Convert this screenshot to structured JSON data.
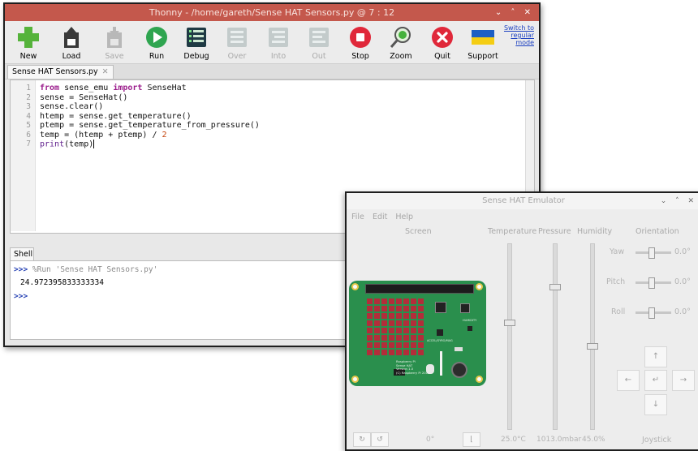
{
  "thonny": {
    "title": "Thonny  -  /home/gareth/Sense HAT Sensors.py  @  7 : 12",
    "window_controls": "⌄ ˄ ✕",
    "toolbar": [
      {
        "label": "New",
        "icon": "new-file-icon",
        "enabled": true
      },
      {
        "label": "Load",
        "icon": "load-icon",
        "enabled": true
      },
      {
        "label": "Save",
        "icon": "save-icon",
        "enabled": false
      },
      {
        "label": "Run",
        "icon": "run-icon",
        "enabled": true
      },
      {
        "label": "Debug",
        "icon": "debug-icon",
        "enabled": true
      },
      {
        "label": "Over",
        "icon": "step-over-icon",
        "enabled": false
      },
      {
        "label": "Into",
        "icon": "step-into-icon",
        "enabled": false
      },
      {
        "label": "Out",
        "icon": "step-out-icon",
        "enabled": false
      },
      {
        "label": "Stop",
        "icon": "stop-icon",
        "enabled": true
      },
      {
        "label": "Zoom",
        "icon": "zoom-icon",
        "enabled": true
      },
      {
        "label": "Quit",
        "icon": "quit-icon",
        "enabled": true
      },
      {
        "label": "Support",
        "icon": "ukraine-flag-icon",
        "enabled": true
      }
    ],
    "switch_mode": {
      "line1": "Switch to",
      "line2": "regular",
      "line3": "mode"
    },
    "editor_tab": {
      "label": "Sense HAT Sensors.py",
      "close": "✕"
    },
    "code_lines": [
      {
        "n": "1",
        "parts": [
          [
            "kw",
            "from"
          ],
          [
            "t",
            " sense_emu "
          ],
          [
            "kw",
            "import"
          ],
          [
            "t",
            " SenseHat"
          ]
        ]
      },
      {
        "n": "2",
        "parts": [
          [
            "t",
            "sense = SenseHat()"
          ]
        ]
      },
      {
        "n": "3",
        "parts": [
          [
            "t",
            "sense.clear()"
          ]
        ]
      },
      {
        "n": "4",
        "parts": [
          [
            "t",
            "htemp = sense.get_temperature()"
          ]
        ]
      },
      {
        "n": "5",
        "parts": [
          [
            "t",
            "ptemp = sense.get_temperature_from_pressure()"
          ]
        ]
      },
      {
        "n": "6",
        "parts": [
          [
            "t",
            "temp = (htemp + ptemp) / "
          ],
          [
            "num",
            "2"
          ]
        ]
      },
      {
        "n": "7",
        "parts": [
          [
            "bi",
            "print"
          ],
          [
            "t",
            "(temp)"
          ]
        ]
      }
    ],
    "shell_tab": "Shell",
    "shell": {
      "prompt": ">>>",
      "run_command": " %Run 'Sense HAT Sensors.py'",
      "output": "24.972395833333334",
      "prompt2": ">>>"
    }
  },
  "emulator": {
    "title": "Sense HAT Emulator",
    "window_controls": "⌄ ˄ ✕",
    "menu": [
      "File",
      "Edit",
      "Help"
    ],
    "headers": {
      "screen": "Screen",
      "temperature": "Temperature",
      "pressure": "Pressure",
      "humidity": "Humidity",
      "orientation": "Orientation"
    },
    "sliders": {
      "temperature": {
        "value_text": "25.0°C",
        "value": 25.0,
        "fraction": 0.58
      },
      "pressure": {
        "value_text": "1013.0mbar",
        "value": 1013.0,
        "fraction": 0.77
      },
      "humidity": {
        "value_text": "45.0%",
        "value": 45.0,
        "fraction": 0.45
      }
    },
    "orientation": [
      {
        "label": "Yaw",
        "value": "0.0°"
      },
      {
        "label": "Pitch",
        "value": "0.0°"
      },
      {
        "label": "Roll",
        "value": "0.0°"
      }
    ],
    "rotate_left": "↻",
    "rotate_right": "↺",
    "rotation_value": "0°",
    "corner_button": "⌊",
    "joystick": {
      "up": "↑",
      "down": "↓",
      "left": "←",
      "right": "→",
      "enter": "↵",
      "label": "Joystick"
    },
    "board_text": {
      "line1": "Raspberry Pi",
      "line2": "Sense HAT",
      "line3": "Version 1.0",
      "line4": "(C) Raspberry Pi 2015",
      "humidity_label": "HUMIDITY",
      "accel_label": "ACCEL/GYRO/MAG"
    },
    "colors": {
      "board": "#2a8f4d",
      "led": "#b32d3a",
      "pad": "#e7c84a"
    }
  }
}
